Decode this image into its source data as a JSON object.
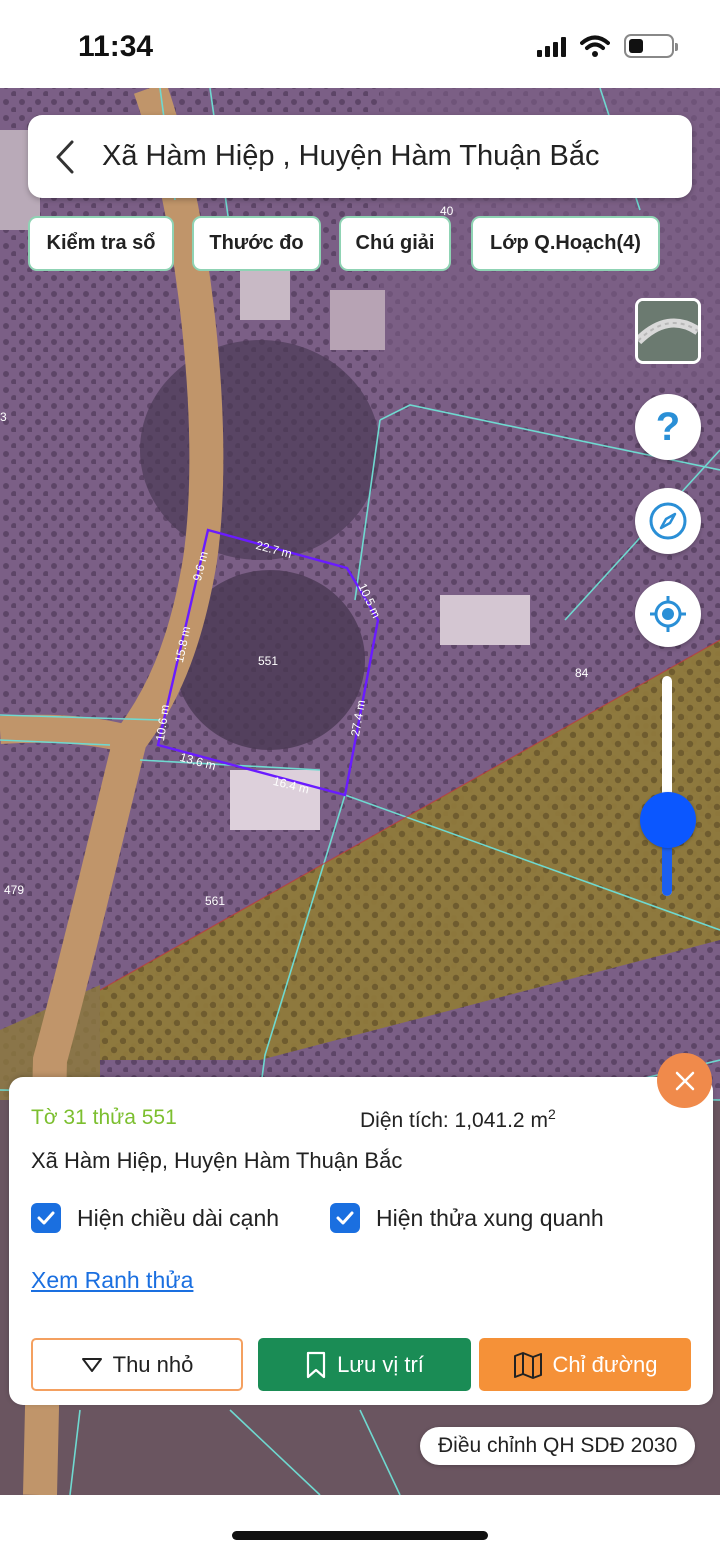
{
  "status_bar": {
    "time": "11:34"
  },
  "header": {
    "title": "Xã Hàm Hiệp , Huyện Hàm Thuận Bắc"
  },
  "toolbar": {
    "chips": [
      "Kiểm tra sổ",
      "Thước đo",
      "Chú giải",
      "Lớp Q.Hoạch(4)"
    ]
  },
  "map": {
    "parcel_numbers": {
      "main": "551",
      "east": "84",
      "south": "561",
      "southwest": "479",
      "north": "40",
      "west": "3"
    },
    "edge_lengths": [
      "22.7 m",
      "10.5 m",
      "27.4 m",
      "16.4 m",
      "13.6 m",
      "10.6 m",
      "15.8 m",
      "9.6 m"
    ],
    "colors": {
      "parcel_boundary": "#6a1bff",
      "land_lines": "#6fd9d0",
      "zone_overlay": "#8f7a3a"
    },
    "zoom_level": 0.37
  },
  "controls": {
    "help": "?"
  },
  "info_panel": {
    "parcel_id": "Tờ 31 thửa 551",
    "area_label": "Diện tích: 1,041.2 m",
    "area_unit_sup": "2",
    "address": "Xã Hàm Hiệp, Huyện Hàm Thuận Bắc",
    "checkbox_edges": "Hiện chiều dài cạnh",
    "checkbox_neighbors": "Hiện thửa xung quanh",
    "link_boundary": "Xem Ranh thửa",
    "btn_shrink": "Thu nhỏ",
    "btn_save": "Lưu vị trí",
    "btn_route": "Chỉ đường"
  },
  "plan_tag": "Điều chỉnh QH SDĐ 2030"
}
